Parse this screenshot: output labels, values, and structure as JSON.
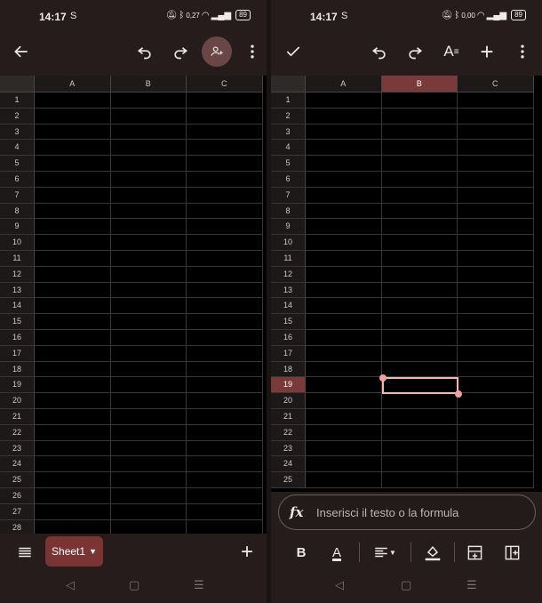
{
  "left": {
    "status": {
      "time": "14:17",
      "mode_icon": "S",
      "data_speed": "0,27",
      "battery": "89"
    },
    "toolbar": {
      "back": "arrow-back-icon",
      "undo": "undo-icon",
      "redo": "redo-icon",
      "share": "person-add-icon",
      "more": "more-vert-icon"
    },
    "columns": [
      "A",
      "B",
      "C"
    ],
    "rows": [
      "1",
      "2",
      "3",
      "4",
      "5",
      "6",
      "7",
      "8",
      "9",
      "10",
      "11",
      "12",
      "13",
      "14",
      "15",
      "16",
      "17",
      "18",
      "19",
      "20",
      "21",
      "22",
      "23",
      "24",
      "25",
      "26",
      "27",
      "28"
    ],
    "sheet_tab": "Sheet1",
    "add_sheet": "+"
  },
  "right": {
    "status": {
      "time": "14:17",
      "mode_icon": "S",
      "data_speed": "0,00",
      "battery": "89"
    },
    "toolbar": {
      "confirm": "check-icon",
      "undo": "undo-icon",
      "redo": "redo-icon",
      "text_format": "text-format-icon",
      "add": "+",
      "more": "more-vert-icon"
    },
    "columns": [
      "A",
      "B",
      "C"
    ],
    "rows": [
      "1",
      "2",
      "3",
      "4",
      "5",
      "6",
      "7",
      "8",
      "9",
      "10",
      "11",
      "12",
      "13",
      "14",
      "15",
      "16",
      "17",
      "18",
      "19",
      "20",
      "21",
      "22",
      "23",
      "24",
      "25"
    ],
    "selected_cell": {
      "column": "B",
      "row": "19"
    },
    "formula_placeholder": "Inserisci il testo o la formula",
    "format": {
      "bold": "B",
      "text_color": "A"
    }
  },
  "colors": {
    "background": "#261c1c",
    "accent": "#7b3434",
    "selection": "#f4b4b4"
  }
}
